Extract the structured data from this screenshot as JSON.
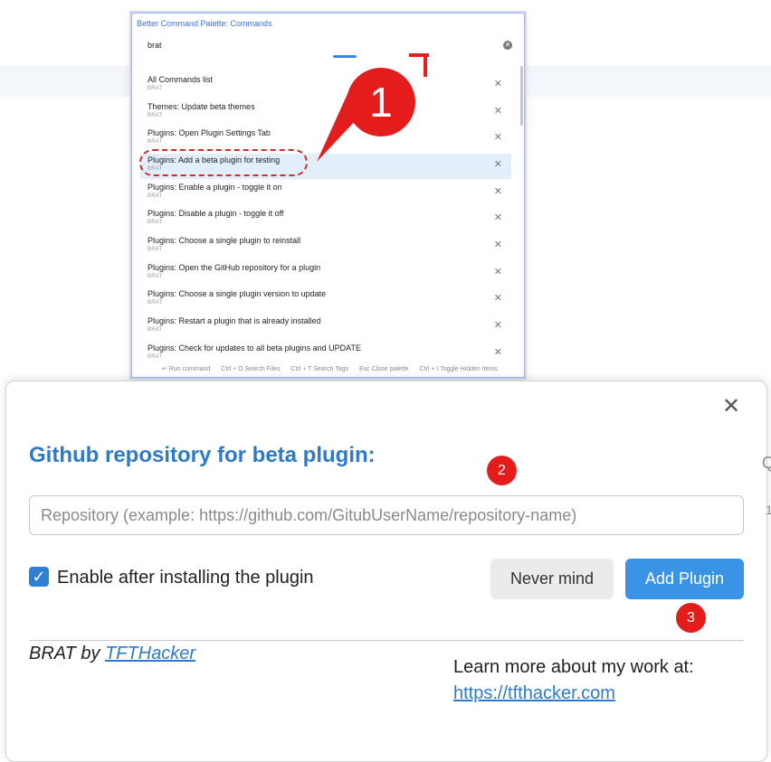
{
  "palette": {
    "title": "Better Command Palette: Commands",
    "search_value": "brat",
    "clear_icon": "clear-circle-icon",
    "rows": [
      {
        "title": "All Commands list",
        "sub": "BRAT"
      },
      {
        "title": "Themes: Update beta themes",
        "sub": "BRAT"
      },
      {
        "title": "Plugins: Open Plugin Settings Tab",
        "sub": "BRAT"
      },
      {
        "title": "Plugins: Add a beta plugin for testing",
        "sub": "BRAT"
      },
      {
        "title": "Plugins: Enable a plugin - toggle it on",
        "sub": "BRAT"
      },
      {
        "title": "Plugins: Disable a plugin - toggle it off",
        "sub": "BRAT"
      },
      {
        "title": "Plugins: Choose a single plugin to reinstall",
        "sub": "BRAT"
      },
      {
        "title": "Plugins: Open the GitHub repository for a plugin",
        "sub": "BRAT"
      },
      {
        "title": "Plugins: Choose a single plugin version to update",
        "sub": "BRAT"
      },
      {
        "title": "Plugins: Restart a plugin that is already installed",
        "sub": "BRAT"
      },
      {
        "title": "Plugins: Check for updates to all beta plugins and UPDATE",
        "sub": "BRAT"
      }
    ],
    "hints": [
      "↵ Run command",
      "Ctrl + O Search Files",
      "Ctrl + T Search Tags",
      "Esc Close palette",
      "Ctrl + I Toggle Hidden Items"
    ]
  },
  "annotations": {
    "badge1": "1",
    "badge2": "2",
    "badge3": "3"
  },
  "dialog": {
    "close": "✕",
    "title": "Github repository for beta plugin:",
    "repo_placeholder": "Repository (example: https://github.com/GitubUserName/repository-name)",
    "enable_label": "Enable after installing the plugin",
    "enable_checked": true,
    "never_mind": "Never mind",
    "add_plugin": "Add Plugin",
    "brat_by": "BRAT by ",
    "brat_link": "TFTHacker",
    "learn_more": "Learn more about my work at:",
    "learn_link": "https://tfthacker.com"
  },
  "colors": {
    "accent": "#2e7ac8",
    "button_blue": "#3b93e6",
    "annotation_red": "#e41c1c"
  }
}
